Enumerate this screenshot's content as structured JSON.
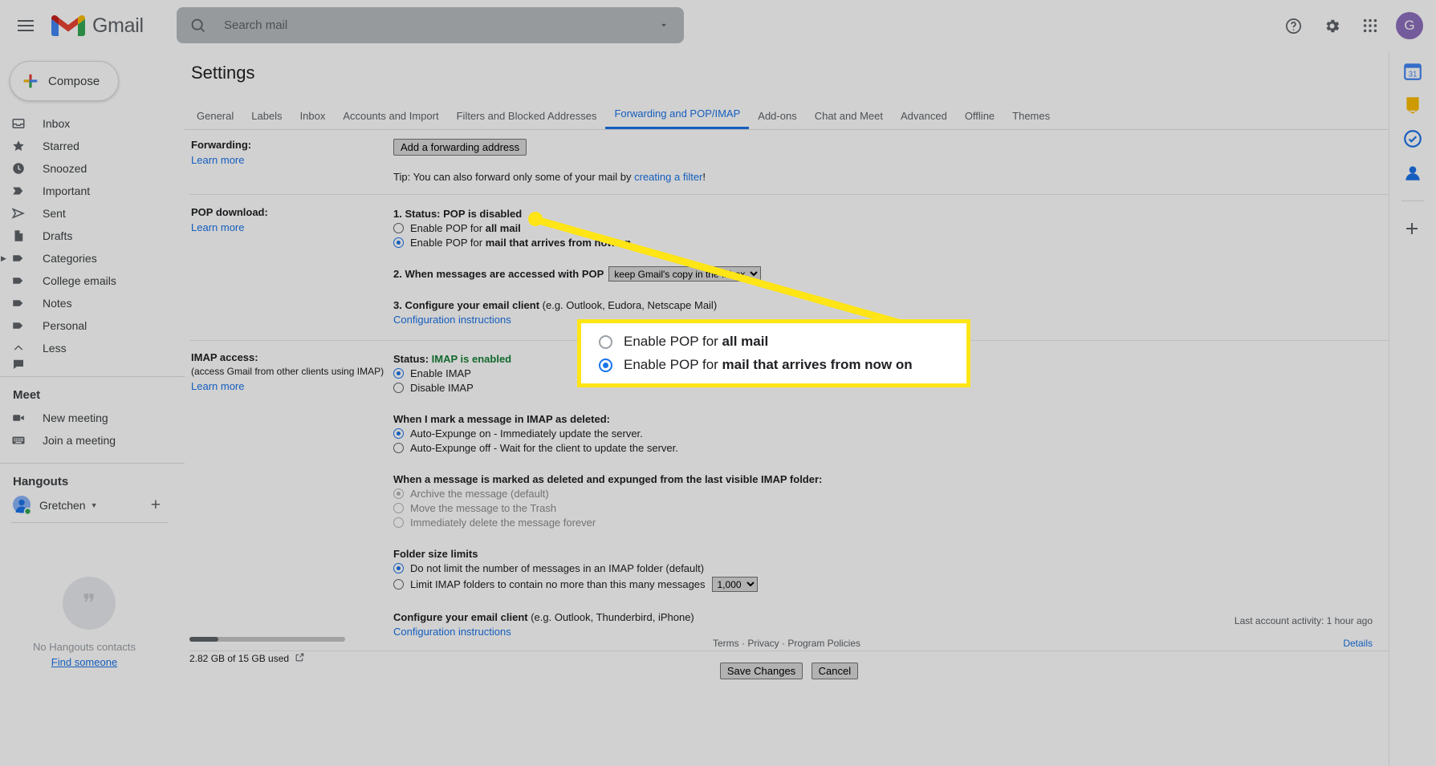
{
  "app": {
    "name": "Gmail",
    "avatar_initial": "G"
  },
  "search": {
    "placeholder": "Search mail",
    "value": "",
    "icon": "search-icon",
    "options_icon": "chevron-down-icon"
  },
  "topbar": {
    "menu_icon": "hamburger-menu-icon",
    "help_icon": "help-icon",
    "settings_icon": "gear-icon",
    "apps_icon": "apps-grid-icon"
  },
  "sidebar": {
    "compose_label": "Compose",
    "items": [
      {
        "label": "Inbox",
        "icon": "inbox-icon"
      },
      {
        "label": "Starred",
        "icon": "star-icon"
      },
      {
        "label": "Snoozed",
        "icon": "clock-icon"
      },
      {
        "label": "Important",
        "icon": "label-important-icon"
      },
      {
        "label": "Sent",
        "icon": "send-icon"
      },
      {
        "label": "Drafts",
        "icon": "draft-icon"
      },
      {
        "label": "Categories",
        "icon": "label-icon",
        "expandable": true
      },
      {
        "label": "College emails",
        "icon": "label-icon"
      },
      {
        "label": "Notes",
        "icon": "label-icon"
      },
      {
        "label": "Personal",
        "icon": "label-icon"
      },
      {
        "label": "Less",
        "icon": "chevron-up-icon"
      }
    ],
    "meet": {
      "title": "Meet",
      "items": [
        {
          "label": "New meeting",
          "icon": "video-camera-icon"
        },
        {
          "label": "Join a meeting",
          "icon": "keyboard-icon"
        }
      ]
    },
    "hangouts": {
      "title": "Hangouts",
      "user": "Gretchen",
      "user_caret": "chevron-down-icon",
      "add_icon": "plus-icon",
      "empty_text": "No Hangouts contacts",
      "find_link": "Find someone"
    }
  },
  "main": {
    "page_title": "Settings",
    "tabs": [
      {
        "label": "General",
        "active": false
      },
      {
        "label": "Labels",
        "active": false
      },
      {
        "label": "Inbox",
        "active": false
      },
      {
        "label": "Accounts and Import",
        "active": false
      },
      {
        "label": "Filters and Blocked Addresses",
        "active": false
      },
      {
        "label": "Forwarding and POP/IMAP",
        "active": true
      },
      {
        "label": "Add-ons",
        "active": false
      },
      {
        "label": "Chat and Meet",
        "active": false
      },
      {
        "label": "Advanced",
        "active": false
      },
      {
        "label": "Offline",
        "active": false
      },
      {
        "label": "Themes",
        "active": false
      }
    ],
    "forwarding": {
      "label": "Forwarding:",
      "learn_more": "Learn more",
      "add_button": "Add a forwarding address",
      "tip_prefix": "Tip: You can also forward only some of your mail by ",
      "tip_link": "creating a filter",
      "tip_suffix": "!"
    },
    "pop": {
      "label": "POP download:",
      "learn_more": "Learn more",
      "step1": "1. Status: POP is disabled",
      "option_all_prefix": "Enable POP for ",
      "option_all_bold": "all mail",
      "option_all_checked": false,
      "option_now_prefix": "Enable POP for ",
      "option_now_bold": "mail that arrives from now on",
      "option_now_checked": true,
      "step2": "2. When messages are accessed with POP",
      "step2_select_value": "keep Gmail's copy in the Inbox",
      "step3_bold": "3. Configure your email client",
      "step3_rest": " (e.g. Outlook, Eudora, Netscape Mail)",
      "config_link": "Configuration instructions"
    },
    "imap": {
      "label": "IMAP access:",
      "sublabel": "(access Gmail from other clients using IMAP)",
      "learn_more": "Learn more",
      "status_prefix": "Status: ",
      "status_value": "IMAP is enabled",
      "enable_label": "Enable IMAP",
      "enable_checked": true,
      "disable_label": "Disable IMAP",
      "disable_checked": false,
      "delete_heading": "When I mark a message in IMAP as deleted:",
      "auto_on": "Auto-Expunge on - Immediately update the server.",
      "auto_on_checked": true,
      "auto_off": "Auto-Expunge off - Wait for the client to update the server.",
      "auto_off_checked": false,
      "expunged_heading": "When a message is marked as deleted and expunged from the last visible IMAP folder:",
      "expunged_options": [
        {
          "label": "Archive the message (default)",
          "checked": true,
          "disabled": true
        },
        {
          "label": "Move the message to the Trash",
          "checked": false,
          "disabled": true
        },
        {
          "label": "Immediately delete the message forever",
          "checked": false,
          "disabled": true
        }
      ],
      "folder_heading": "Folder size limits",
      "folder_nolimit": "Do not limit the number of messages in an IMAP folder (default)",
      "folder_nolimit_checked": true,
      "folder_limit": "Limit IMAP folders to contain no more than this many messages",
      "folder_limit_checked": false,
      "folder_limit_value": "1,000",
      "configure_bold": "Configure your email client",
      "configure_rest": " (e.g. Outlook, Thunderbird, iPhone)",
      "config_link": "Configuration instructions"
    },
    "actions": {
      "save_label": "Save Changes",
      "cancel_label": "Cancel"
    },
    "footer": {
      "storage_text": "2.82 GB of 15 GB used",
      "storage_icon": "external-link-icon",
      "storage_percent": 18,
      "terms": "Terms",
      "privacy": "Privacy",
      "program_policies": "Program Policies",
      "separator": " · ",
      "activity": "Last account activity: 1 hour ago",
      "details": "Details"
    }
  },
  "right_rail": {
    "icons": [
      "calendar-icon",
      "keep-icon",
      "tasks-icon",
      "contacts-icon",
      "add-apps-icon"
    ]
  },
  "callout": {
    "option_all_prefix": "Enable POP for ",
    "option_all_bold": "all mail",
    "option_all_checked": false,
    "option_now_prefix": "Enable POP for ",
    "option_now_bold": "mail that arrives from now on",
    "option_now_checked": true,
    "highlight_color": "#ffe515"
  }
}
